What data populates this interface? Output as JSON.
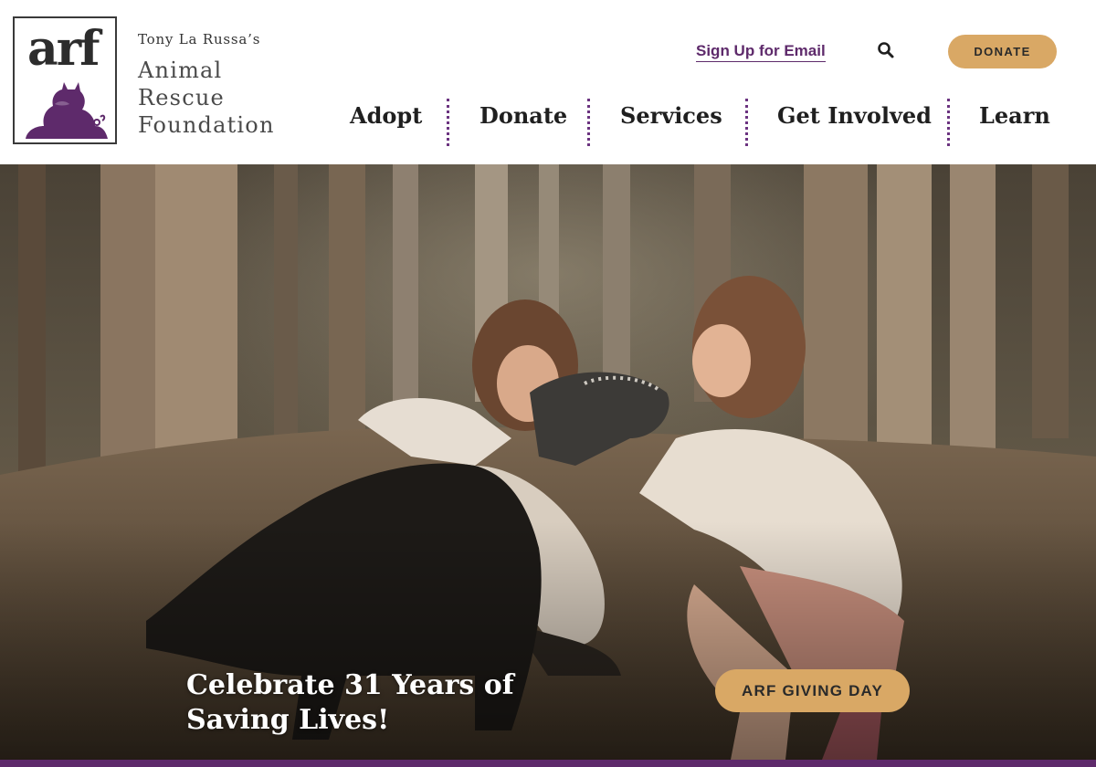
{
  "brand": {
    "logo_text": "arf",
    "tagline": "Tony La Russa’s",
    "name_lines": [
      "Animal",
      "Rescue",
      "Foundation"
    ],
    "logo_color": "#5e2a6b"
  },
  "utility_nav": {
    "signup_label": "Sign Up for Email",
    "search_icon": "search-icon",
    "donate_label": "DONATE"
  },
  "main_nav": {
    "items": [
      {
        "label": "Adopt"
      },
      {
        "label": "Donate"
      },
      {
        "label": "Services"
      },
      {
        "label": "Get Involved"
      },
      {
        "label": "Learn"
      }
    ]
  },
  "hero": {
    "headline_lines": [
      "Celebrate 31 Years of",
      "Saving Lives!"
    ],
    "cta_label": "ARF GIVING DAY"
  },
  "colors": {
    "accent_purple": "#5e2a6b",
    "button_gold": "#d9a865"
  }
}
